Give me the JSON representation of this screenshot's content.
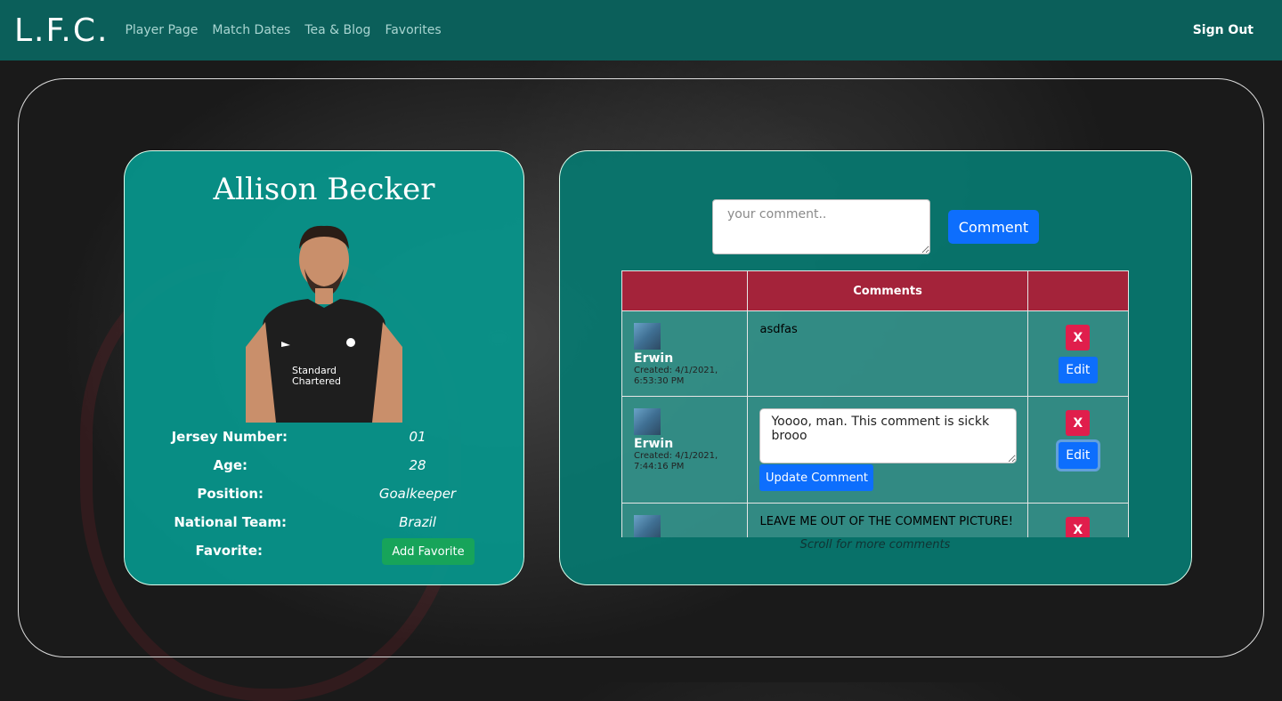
{
  "navbar": {
    "brand": "L.F.C.",
    "links": [
      "Player Page",
      "Match Dates",
      "Tea & Blog",
      "Favorites"
    ],
    "sign_out": "Sign Out"
  },
  "player": {
    "name": "Allison Becker",
    "stats": [
      {
        "label": "Jersey Number:",
        "value": "01"
      },
      {
        "label": "Age:",
        "value": "28"
      },
      {
        "label": "Position:",
        "value": "Goalkeeper"
      },
      {
        "label": "National Team:",
        "value": "Brazil"
      },
      {
        "label": "Favorite:",
        "value": ""
      }
    ],
    "favorite_button": "Add Favorite"
  },
  "comments": {
    "input_placeholder": "your comment..",
    "submit_label": "Comment",
    "header": "Comments",
    "rows": [
      {
        "author": "Erwin",
        "created": "Created: 4/1/2021, 6:53:30 PM",
        "text": "asdfas",
        "delete_label": "X",
        "edit_label": "Edit"
      },
      {
        "author": "Erwin",
        "created": "Created: 4/1/2021, 7:44:16 PM",
        "edit_value": "Yoooo, man. This comment is sickk brooo",
        "update_label": "Update Comment",
        "delete_label": "X",
        "edit_label": "Edit"
      },
      {
        "author": "",
        "created": "",
        "text": "LEAVE ME OUT OF THE COMMENT PICTURE!",
        "delete_label": "X"
      }
    ],
    "scroll_hint": "Scroll for more comments"
  }
}
